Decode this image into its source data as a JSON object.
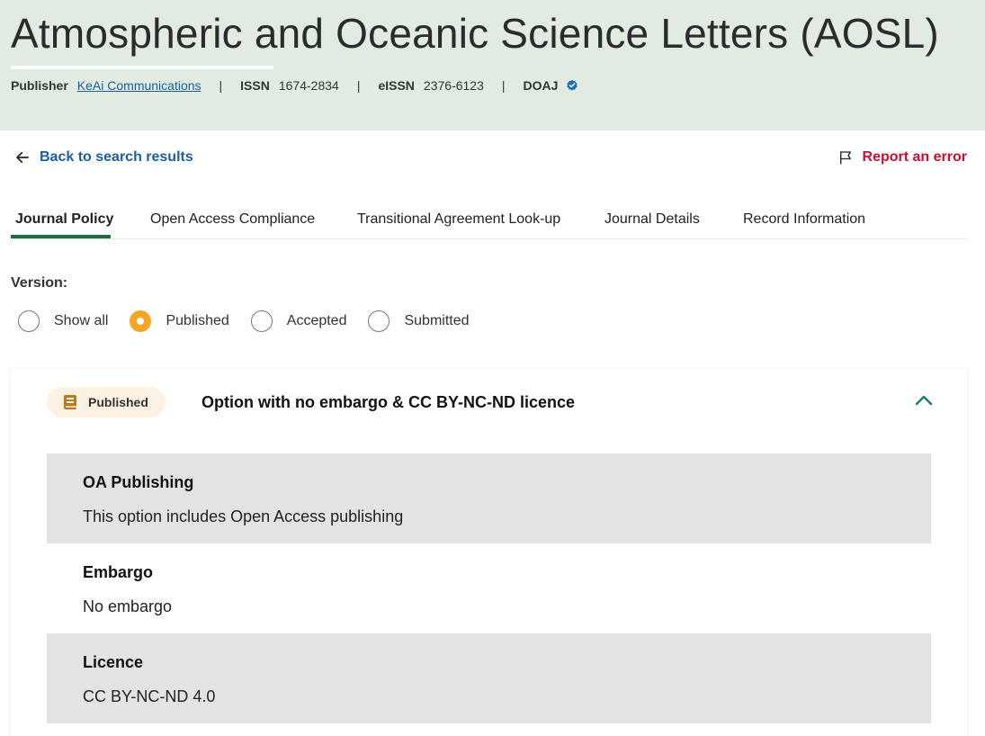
{
  "header": {
    "title": "Atmospheric and Oceanic Science Letters (AOSL)",
    "publisher_label": "Publisher",
    "publisher_value": "KeAi Communications",
    "issn_label": "ISSN",
    "issn_value": "1674-2834",
    "eissn_label": "eISSN",
    "eissn_value": "2376-6123",
    "doaj_label": "DOAJ",
    "separator": "|"
  },
  "nav": {
    "back_label": "Back to search results",
    "report_label": "Report an error"
  },
  "tabs": [
    {
      "label": "Journal Policy",
      "active": true
    },
    {
      "label": "Open Access Compliance"
    },
    {
      "label": "Transitional Agreement Look-up"
    },
    {
      "label": "Journal Details"
    },
    {
      "label": "Record Information"
    }
  ],
  "version": {
    "label": "Version:",
    "options": [
      {
        "label": "Show all",
        "selected": false
      },
      {
        "label": "Published",
        "selected": true
      },
      {
        "label": "Accepted",
        "selected": false
      },
      {
        "label": "Submitted",
        "selected": false
      }
    ]
  },
  "policy": {
    "badge": "Published",
    "title": "Option with no embargo & CC BY-NC-ND licence",
    "rows": [
      {
        "title": "OA Publishing",
        "value": "This option includes Open Access publishing"
      },
      {
        "title": "Embargo",
        "value": "No embargo"
      },
      {
        "title": "Licence",
        "value": "CC BY-NC-ND 4.0"
      }
    ]
  },
  "colors": {
    "header_bg": "#e1ebe2",
    "link": "#1a5f9e",
    "report": "#c8102e",
    "active_tab": "#1e6e3c",
    "radio_selected": "#f5a623",
    "badge_bg": "#fdf1e3",
    "row_grey": "#e3e3e3"
  },
  "icons": [
    "back-arrow-icon",
    "flag-icon",
    "verified-badge-icon",
    "book-icon",
    "chevron-up-icon"
  ]
}
